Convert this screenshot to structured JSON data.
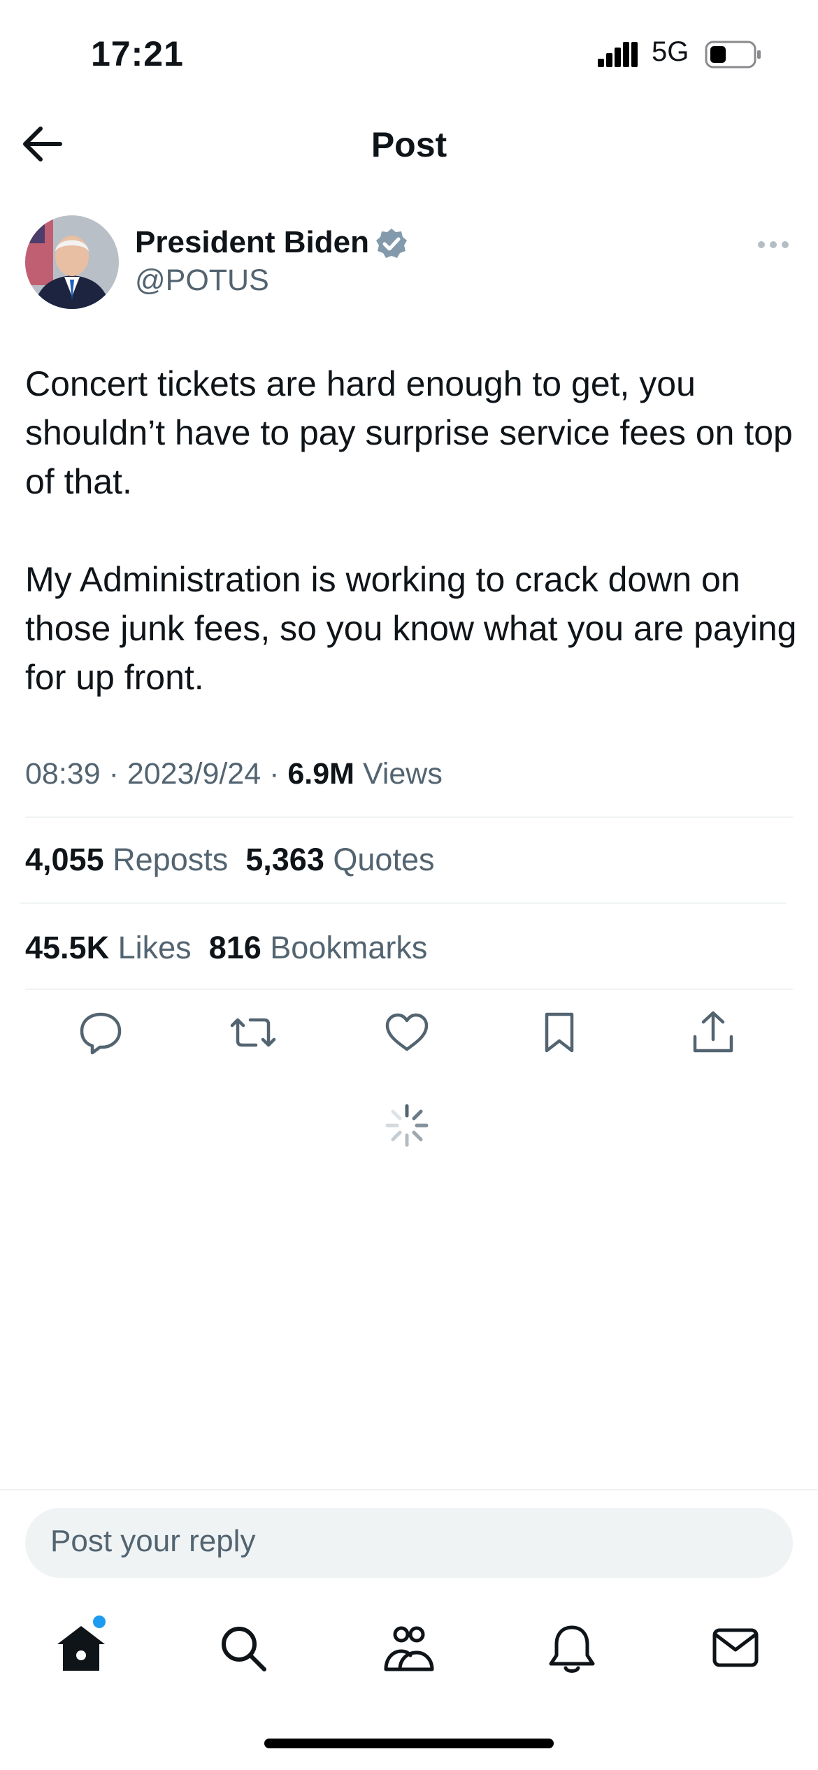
{
  "status_bar": {
    "time": "17:21",
    "network": "5G",
    "icons": [
      "signal-icon",
      "battery-icon"
    ]
  },
  "header": {
    "title": "Post",
    "back_icon": "back-arrow-icon"
  },
  "author": {
    "name": "President Biden",
    "handle": "@POTUS",
    "verified_icon": "verified-badge-icon",
    "badge_color": "#829aab"
  },
  "post": {
    "paragraphs": [
      "Concert tickets are hard enough to get, you shouldn’t have to pay surprise service fees on top of that.",
      "My Administration is working to crack down on those junk fees, so you know what you are paying for up front."
    ],
    "time": "08:39",
    "separator": "·",
    "date": "2023/9/24",
    "views_count": "6.9M",
    "views_label": "Views"
  },
  "stats": {
    "reposts_count": "4,055",
    "reposts_label": "Reposts",
    "quotes_count": "5,363",
    "quotes_label": "Quotes",
    "likes_count": "45.5K",
    "likes_label": "Likes",
    "bookmarks_count": "816",
    "bookmarks_label": "Bookmarks"
  },
  "actions": [
    "reply-icon",
    "repost-icon",
    "like-icon",
    "bookmark-icon",
    "share-icon"
  ],
  "reply": {
    "placeholder": "Post your reply"
  },
  "tab_bar": {
    "items": [
      "home-icon",
      "search-icon",
      "communities-icon",
      "notifications-icon",
      "messages-icon"
    ],
    "accent_color": "#1d9bf0"
  }
}
